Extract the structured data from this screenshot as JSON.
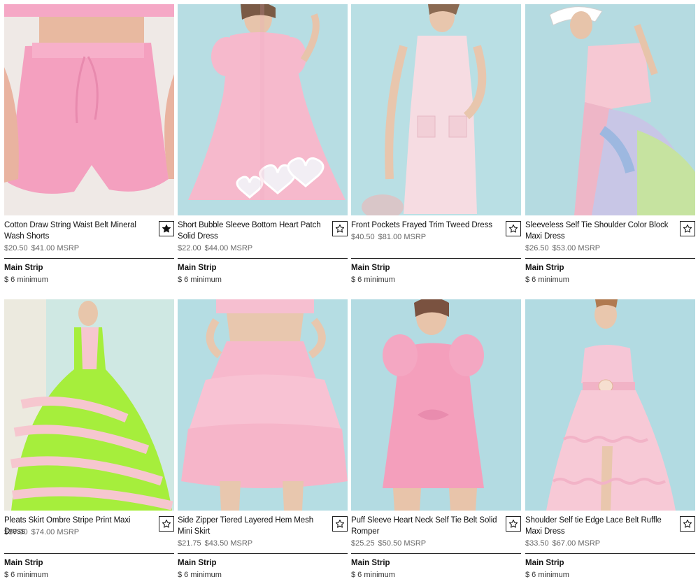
{
  "products": [
    {
      "title": "Cotton Draw String Waist Belt Mineral Wash Shorts",
      "price": "$20.50",
      "msrp": "$41.00 MSRP",
      "vendor": "Main Strip",
      "minimum": "$ 6 minimum",
      "favorited": true,
      "image_icon": "pink-shorts-photo"
    },
    {
      "title": "Short Bubble Sleeve Bottom Heart Patch Solid Dress",
      "price": "$22.00",
      "msrp": "$44.00 MSRP",
      "vendor": "Main Strip",
      "minimum": "$ 6 minimum",
      "favorited": false,
      "image_icon": "pink-heart-dress-photo"
    },
    {
      "title": "Front Pockets Frayed Trim Tweed Dress",
      "price": "$40.50",
      "msrp": "$81.00 MSRP",
      "vendor": "Main Strip",
      "minimum": "$ 6 minimum",
      "favorited": false,
      "image_icon": "tweed-dress-photo"
    },
    {
      "title": "Sleeveless Self Tie Shoulder Color Block Maxi Dress",
      "price": "$26.50",
      "msrp": "$53.00 MSRP",
      "vendor": "Main Strip",
      "minimum": "$ 6 minimum",
      "favorited": false,
      "image_icon": "color-block-maxi-photo"
    },
    {
      "title": "Pleats Skirt Ombre Stripe Print Maxi Dress",
      "price": "$37.00",
      "msrp": "$74.00 MSRP",
      "vendor": "Main Strip",
      "minimum": "$ 6 minimum",
      "favorited": false,
      "image_icon": "stripe-maxi-photo"
    },
    {
      "title": "Side Zipper Tiered Layered Hem Mesh Mini Skirt",
      "price": "$21.75",
      "msrp": "$43.50 MSRP",
      "vendor": "Main Strip",
      "minimum": "$ 6 minimum",
      "favorited": false,
      "image_icon": "tulle-skirt-photo"
    },
    {
      "title": "Puff Sleeve Heart Neck Self Tie Belt Solid Romper",
      "price": "$25.25",
      "msrp": "$50.50 MSRP",
      "vendor": "Main Strip",
      "minimum": "$ 6 minimum",
      "favorited": false,
      "image_icon": "pink-romper-photo"
    },
    {
      "title": "Shoulder Self tie Edge Lace Belt Ruffle Maxi Dress",
      "price": "$33.50",
      "msrp": "$67.00 MSRP",
      "vendor": "Main Strip",
      "minimum": "$ 6 minimum",
      "favorited": false,
      "image_icon": "ruffle-maxi-photo"
    }
  ],
  "colors": {
    "backdrop_blue": "#a9d4dc",
    "pink": "#f1a6c4",
    "light_pink": "#f7c9d6",
    "lime": "#a4ec3a",
    "price_gray": "#666666"
  }
}
